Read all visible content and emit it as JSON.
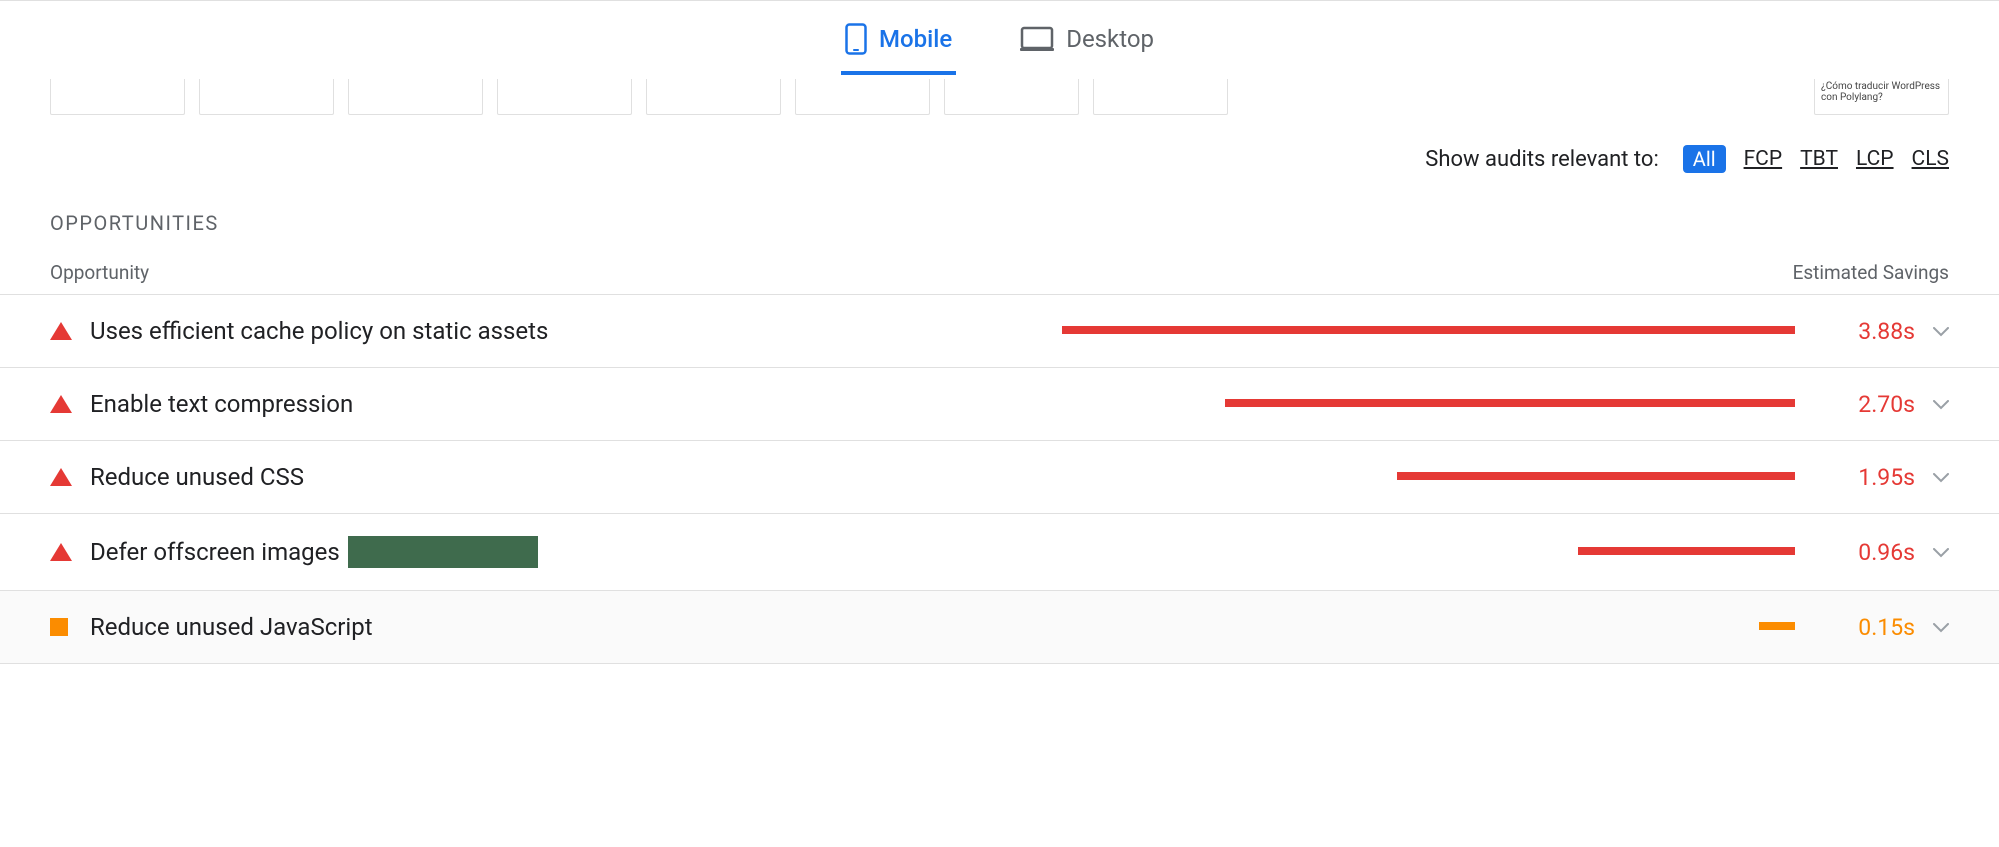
{
  "tabs": {
    "mobile": "Mobile",
    "desktop": "Desktop"
  },
  "thumb_snippet": "¿Cómo traducir WordPress con Polylang?",
  "filter": {
    "label": "Show audits relevant to:",
    "all": "All",
    "items": [
      "FCP",
      "TBT",
      "LCP",
      "CLS"
    ]
  },
  "section_heading": "OPPORTUNITIES",
  "columns": {
    "opportunity": "Opportunity",
    "estimated": "Estimated Savings"
  },
  "rows": [
    {
      "severity": "red",
      "label": "Uses efficient cache policy on static assets",
      "bar_pct": 81,
      "value": "3.88s"
    },
    {
      "severity": "red",
      "label": "Enable text compression",
      "bar_pct": 63,
      "value": "2.70s"
    },
    {
      "severity": "red",
      "label": "Reduce unused CSS",
      "bar_pct": 44,
      "value": "1.95s"
    },
    {
      "severity": "red",
      "label": "Defer offscreen images",
      "bar_pct": 24,
      "value": "0.96s",
      "redacted": true
    },
    {
      "severity": "orange",
      "label": "Reduce unused JavaScript",
      "bar_pct": 4,
      "value": "0.15s",
      "highlight": true
    }
  ]
}
